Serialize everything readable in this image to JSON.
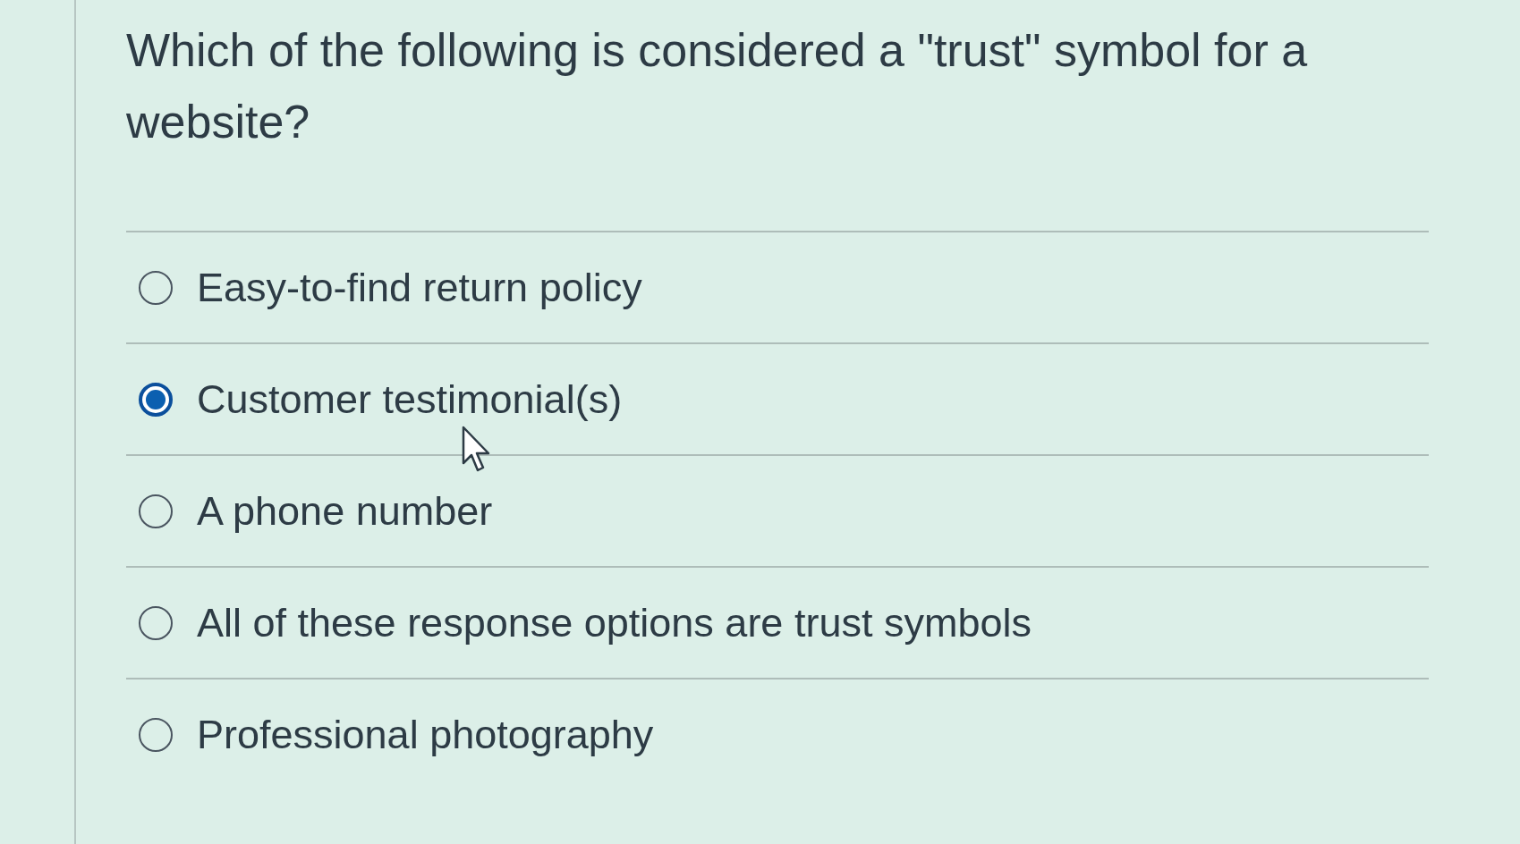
{
  "question": {
    "text": "Which of the following is considered a \"trust\" symbol for a website?"
  },
  "options": [
    {
      "label": "Easy-to-find return policy",
      "selected": false
    },
    {
      "label": "Customer testimonial(s)",
      "selected": true
    },
    {
      "label": "A phone number",
      "selected": false
    },
    {
      "label": "All of these response options are trust symbols",
      "selected": false
    },
    {
      "label": "Professional photography",
      "selected": false
    }
  ]
}
